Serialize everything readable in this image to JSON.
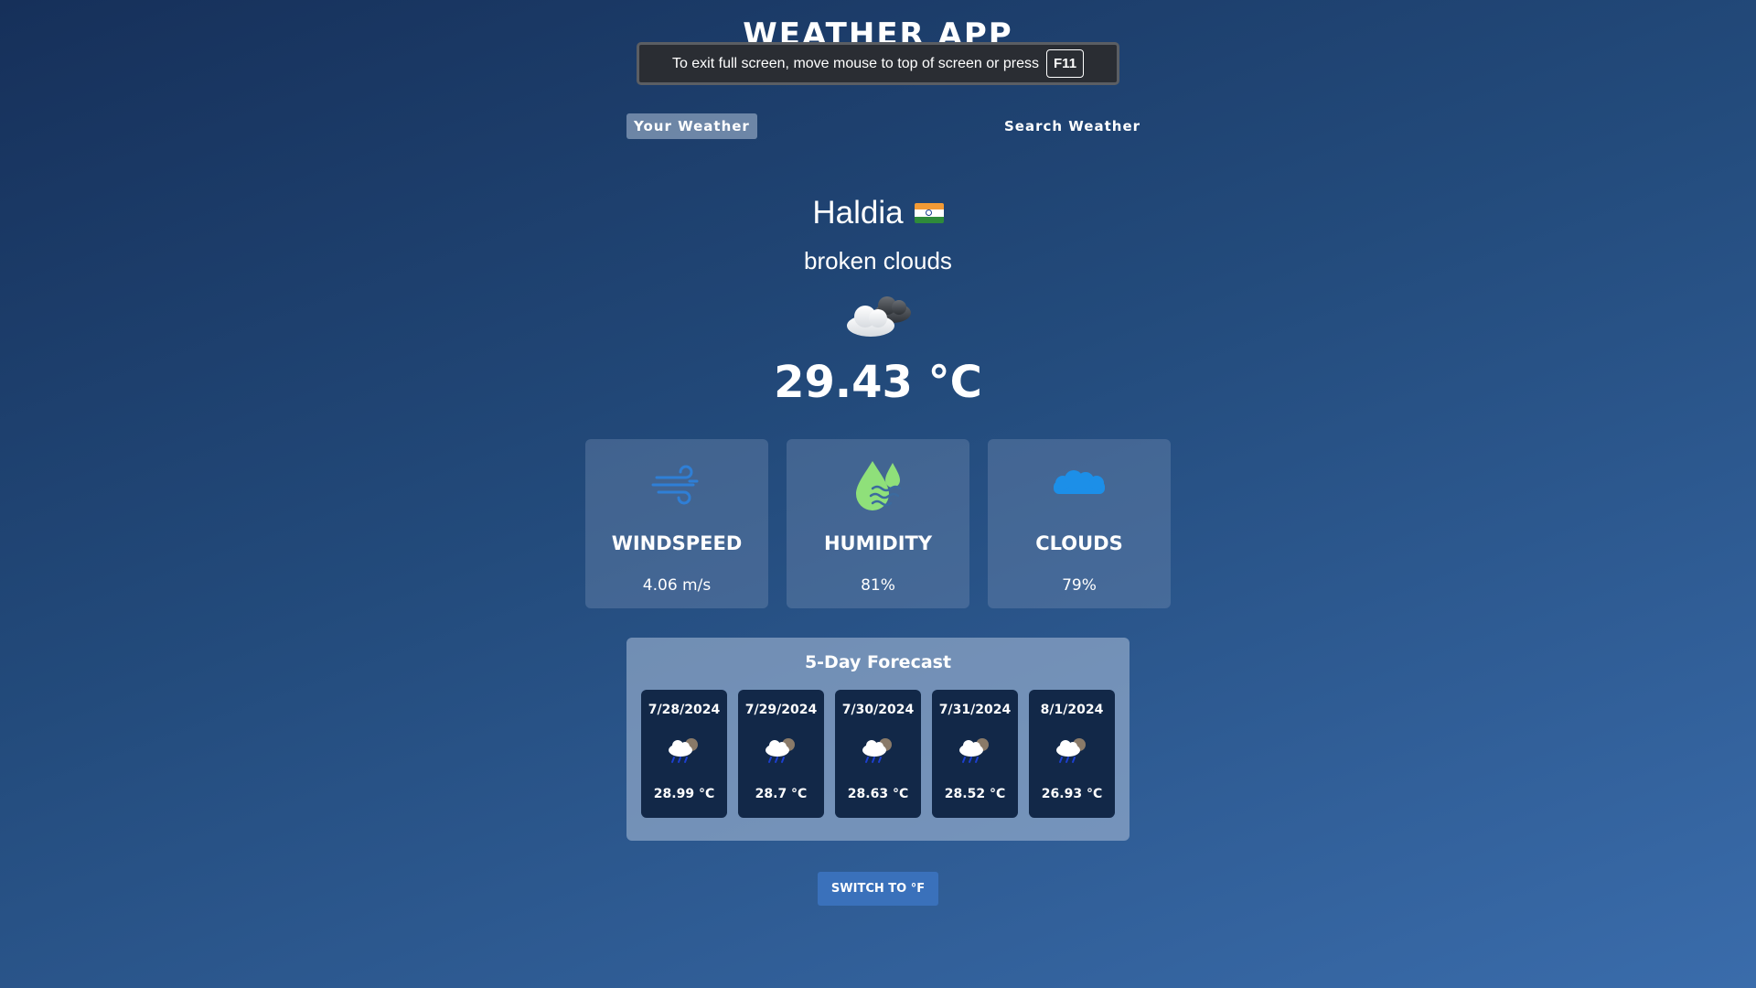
{
  "app": {
    "title": "WEATHER APP"
  },
  "fullscreen_notice": {
    "text": "To exit full screen, move mouse to top of screen or press",
    "key": "F11"
  },
  "tabs": [
    {
      "label": "Your Weather",
      "active": true
    },
    {
      "label": "Search Weather",
      "active": false
    }
  ],
  "current": {
    "city": "Haldia",
    "country_flag": "india-flag-icon",
    "description": "broken clouds",
    "icon": "broken-clouds-icon",
    "temperature": "29.43 °C"
  },
  "stats": [
    {
      "label": "WINDSPEED",
      "value": "4.06 m/s",
      "icon": "wind-icon",
      "color": "#2f7fd6"
    },
    {
      "label": "HUMIDITY",
      "value": "81%",
      "icon": "humidity-drop-icon",
      "color": "#8fe07a"
    },
    {
      "label": "CLOUDS",
      "value": "79%",
      "icon": "cloud-icon",
      "color": "#1c8fe8"
    }
  ],
  "forecast": {
    "title": "5-Day Forecast",
    "days": [
      {
        "date": "7/28/2024",
        "temp": "28.99 °C",
        "icon": "rain-cloud-icon"
      },
      {
        "date": "7/29/2024",
        "temp": "28.7 °C",
        "icon": "rain-cloud-icon"
      },
      {
        "date": "7/30/2024",
        "temp": "28.63 °C",
        "icon": "rain-cloud-icon"
      },
      {
        "date": "7/31/2024",
        "temp": "28.52 °C",
        "icon": "rain-cloud-icon"
      },
      {
        "date": "8/1/2024",
        "temp": "26.93 °C",
        "icon": "rain-cloud-icon"
      }
    ]
  },
  "unit_toggle": {
    "label": "SWITCH TO °F"
  },
  "colors": {
    "background_top": "#16305a",
    "background_bottom": "#3a6cab",
    "forecast_panel": "#a0b4d2",
    "forecast_card": "#122848",
    "button": "#3a71bb"
  }
}
